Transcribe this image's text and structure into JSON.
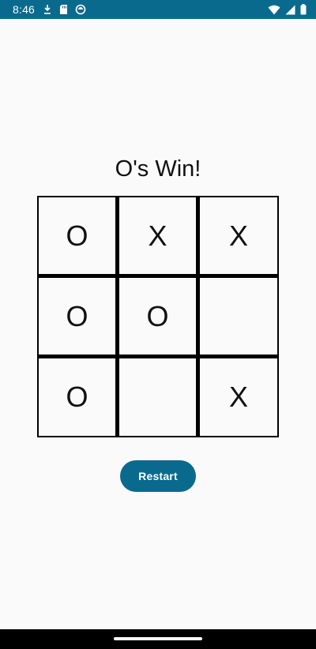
{
  "status_bar": {
    "time": "8:46",
    "left_icons": [
      "download-icon",
      "sd-card-icon",
      "sync-icon"
    ],
    "right_icons": [
      "wifi-icon",
      "cellular-signal-icon",
      "battery-icon"
    ],
    "color": "#0a6a8e"
  },
  "game": {
    "status_text": "O's Win!",
    "board": [
      [
        "O",
        "X",
        "X"
      ],
      [
        "O",
        "O",
        ""
      ],
      [
        "O",
        "",
        "X"
      ]
    ]
  },
  "restart_button": {
    "label": "Restart",
    "color": "#0a6a8e"
  }
}
